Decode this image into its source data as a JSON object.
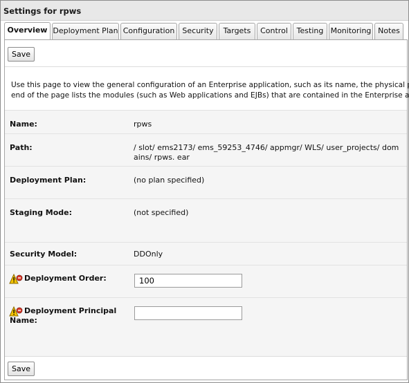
{
  "window": {
    "title": "Settings for rpws"
  },
  "tabs": [
    {
      "label": "Overview",
      "active": true
    },
    {
      "label": "Deployment Plan"
    },
    {
      "label": "Configuration"
    },
    {
      "label": "Security"
    },
    {
      "label": "Targets"
    },
    {
      "label": "Control"
    },
    {
      "label": "Testing"
    },
    {
      "label": "Monitoring"
    },
    {
      "label": "Notes"
    }
  ],
  "buttons": {
    "save_top": "Save",
    "save_bottom": "Save"
  },
  "intro": {
    "line1": "Use this page to view the general configuration of an Enterprise application, such as its name, the physical path to the",
    "line2": "end of the page lists the modules (such as Web applications and EJBs) that are contained in the Enterprise application."
  },
  "fields": {
    "name": {
      "label": "Name:",
      "value": "rpws"
    },
    "path": {
      "label": "Path:",
      "value": "/ slot/ ems2173/ ems_59253_4746/ appmgr/ WLS/ user_projects/ domains/ rpws. ear"
    },
    "deployment_plan": {
      "label": "Deployment Plan:",
      "value": "(no plan specified)"
    },
    "staging_mode": {
      "label": "Staging Mode:",
      "value": "(not specified)"
    },
    "security_model": {
      "label": "Security Model:",
      "value": "DDOnly"
    },
    "deployment_order": {
      "label": "Deployment Order:",
      "value": "100"
    },
    "deployment_principal": {
      "label_line1": "Deployment Principal",
      "label_line2": "Name:",
      "value": ""
    }
  },
  "icons": {
    "warning": "warning-restart-icon"
  },
  "colors": {
    "title_bg": "#e8e8e8",
    "row_bg": "#f5f5f5",
    "warning": "#f5c400"
  }
}
